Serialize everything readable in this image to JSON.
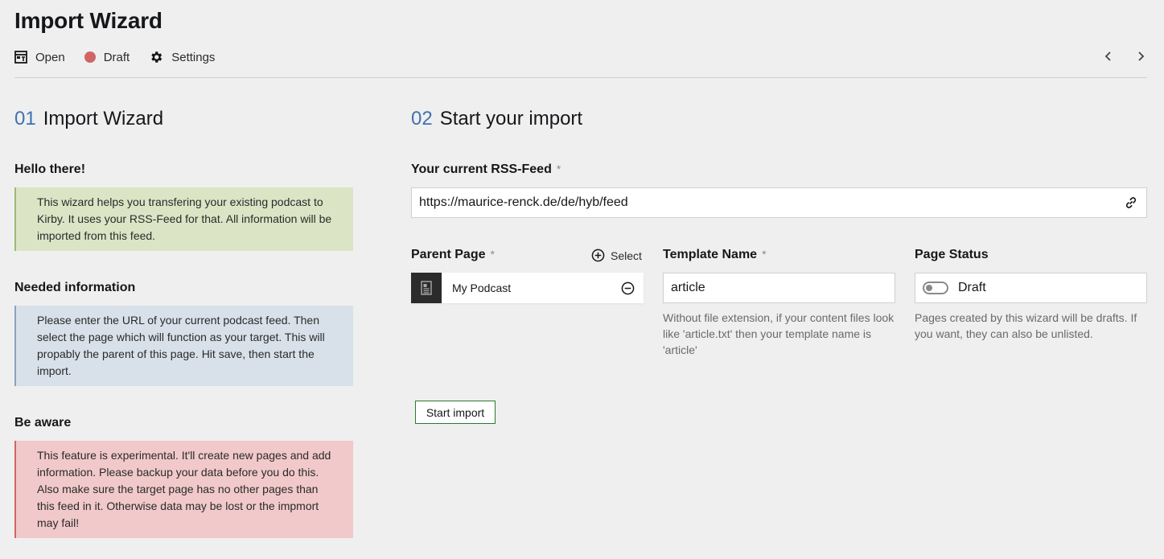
{
  "header": {
    "title": "Import Wizard",
    "toolbar": {
      "open_label": "Open",
      "status_label": "Draft",
      "settings_label": "Settings"
    },
    "status_color": "#d16464"
  },
  "left": {
    "section_number": "01",
    "section_title": "Import Wizard",
    "hello_heading": "Hello there!",
    "hello_text": "This wizard helps you transfering your existing podcast to Kirby. It uses your RSS-Feed for that. All information will be imported from this feed.",
    "needed_heading": "Needed information",
    "needed_text": "Please enter the URL of your current podcast feed. Then select the page which will function as your target. This will propably the parent of this page. Hit save, then start the import.",
    "aware_heading": "Be aware",
    "aware_text": "This feature is experimental. It'll create new pages and add information. Please backup your data before you do this. Also make sure the target page has no other pages than this feed in it. Otherwise data may be lost or the impmort may fail!"
  },
  "right": {
    "section_number": "02",
    "section_title": "Start your import",
    "rss": {
      "label": "Your current RSS-Feed",
      "required_mark": "*",
      "value": "https://maurice-renck.de/de/hyb/feed"
    },
    "parent": {
      "label": "Parent Page",
      "required_mark": "*",
      "select_label": "Select",
      "selected_page": "My Podcast"
    },
    "template": {
      "label": "Template Name",
      "required_mark": "*",
      "value": "article",
      "help": "Without file extension, if your content files look like 'article.txt' then your template name is 'article'"
    },
    "status": {
      "label": "Page Status",
      "value": "Draft",
      "help": "Pages created by this wizard will be drafts. If you want, they can also be unlisted."
    },
    "start_button": "Start import"
  },
  "colors": {
    "accent": "#4271ae",
    "positive_bg": "#dbe5c6",
    "info_bg": "#d8e1ea",
    "negative_bg": "#f1c9ca",
    "button_border": "#2c7a2c"
  },
  "icons": [
    "open-icon",
    "status-dot-icon",
    "gear-icon",
    "chevron-left-icon",
    "chevron-right-icon",
    "link-icon",
    "add-circle-icon",
    "page-icon",
    "remove-circle-icon"
  ]
}
